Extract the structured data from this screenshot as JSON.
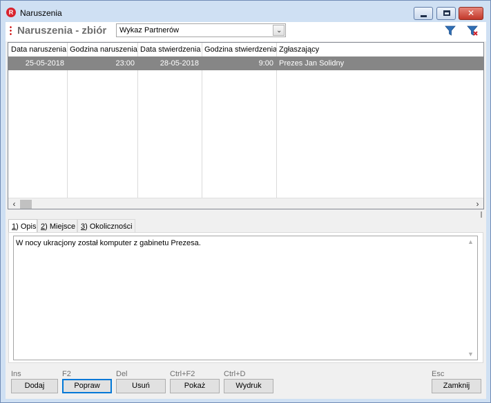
{
  "window": {
    "title": "Naruszenia",
    "app_icon_letter": "R",
    "controls": {
      "minimize": "minimize-icon",
      "maximize": "maximize-icon",
      "close": "close-icon"
    }
  },
  "toolbar": {
    "title": "Naruszenia - zbiór",
    "combo_value": "Wykaz Partnerów",
    "filter_icon": "filter-icon",
    "clear_filter_icon": "filter-clear-icon"
  },
  "grid": {
    "columns": [
      "Data naruszenia",
      "Godzina naruszenia",
      "Data stwierdzenia",
      "Godzina stwierdzenia",
      "Zgłaszający"
    ],
    "rows": [
      [
        "25-05-2018",
        "23:00",
        "28-05-2018",
        "9:00",
        "Prezes Jan Solidny"
      ]
    ],
    "selection_color": "#868686"
  },
  "tabs": [
    {
      "key": "1",
      "label": ") Opis"
    },
    {
      "key": "2",
      "label": ") Miejsce"
    },
    {
      "key": "3",
      "label": ") Okoliczności"
    }
  ],
  "memo": {
    "text": "W nocy ukracjony został komputer z gabinetu Prezesa."
  },
  "buttons": [
    {
      "shortcut": "Ins",
      "label": "Dodaj"
    },
    {
      "shortcut": "F2",
      "label": "Popraw"
    },
    {
      "shortcut": "Del",
      "label": "Usuń"
    },
    {
      "shortcut": "Ctrl+F2",
      "label": "Pokaż"
    },
    {
      "shortcut": "Ctrl+D",
      "label": "Wydruk"
    },
    {
      "shortcut": "Esc",
      "label": "Zamknij"
    }
  ]
}
